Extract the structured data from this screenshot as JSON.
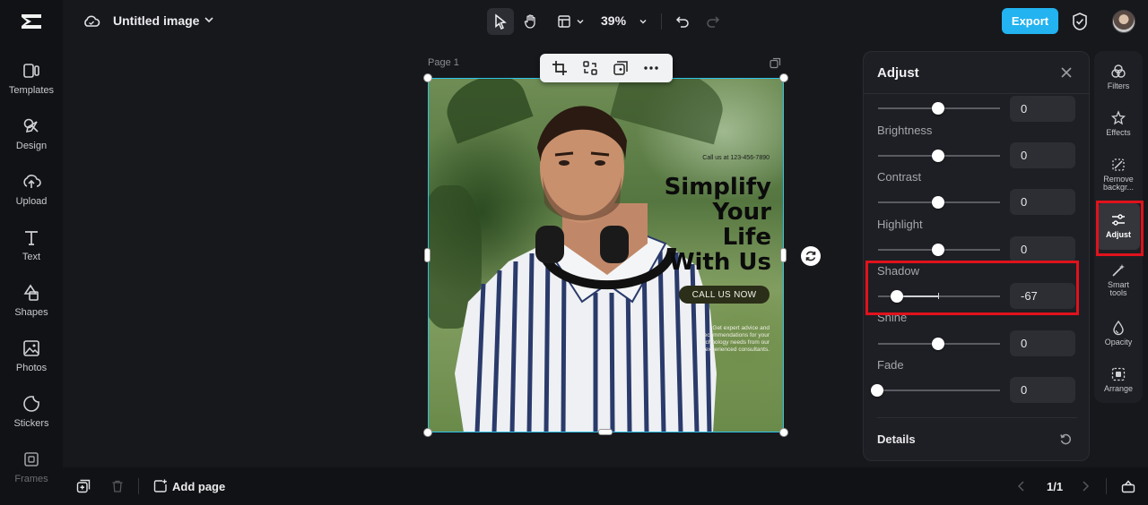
{
  "app": {
    "document_title": "Untitled image"
  },
  "left_nav": {
    "items": [
      {
        "label": "Templates",
        "icon": "templates-icon"
      },
      {
        "label": "Design",
        "icon": "design-icon"
      },
      {
        "label": "Upload",
        "icon": "upload-icon"
      },
      {
        "label": "Text",
        "icon": "text-icon"
      },
      {
        "label": "Shapes",
        "icon": "shapes-icon"
      },
      {
        "label": "Photos",
        "icon": "photos-icon"
      },
      {
        "label": "Stickers",
        "icon": "stickers-icon"
      },
      {
        "label": "Frames",
        "icon": "frames-icon"
      }
    ]
  },
  "toolbar": {
    "zoom": "39%",
    "export_label": "Export"
  },
  "canvas": {
    "page_label": "Page 1",
    "design": {
      "phone_line": "Call us at 123-456-7890",
      "headline": [
        "Simplify",
        "Your",
        "Life",
        "With Us"
      ],
      "cta": "CALL US NOW",
      "body": "Get expert advice and recommendations for your technology needs from our experienced consultants."
    }
  },
  "adjust_panel": {
    "title": "Adjust",
    "sliders": [
      {
        "label": "",
        "value": "0"
      },
      {
        "label": "Brightness",
        "value": "0"
      },
      {
        "label": "Contrast",
        "value": "0"
      },
      {
        "label": "Highlight",
        "value": "0"
      },
      {
        "label": "Shadow",
        "value": "-67"
      },
      {
        "label": "Shine",
        "value": "0"
      },
      {
        "label": "Fade",
        "value": "0"
      }
    ],
    "details_label": "Details"
  },
  "right_rail": {
    "items": [
      {
        "label": "Filters"
      },
      {
        "label": "Effects"
      },
      {
        "label": "Remove backgr..."
      },
      {
        "label": "Adjust"
      },
      {
        "label": "Smart tools"
      },
      {
        "label": "Opacity"
      },
      {
        "label": "Arrange"
      }
    ]
  },
  "bottom_bar": {
    "add_page_label": "Add page",
    "page_count": "1/1"
  },
  "colors": {
    "accent": "#22b3f0",
    "selection": "#2bc3e8",
    "highlight": "#e0121c",
    "panel_bg": "#1e1f24"
  }
}
